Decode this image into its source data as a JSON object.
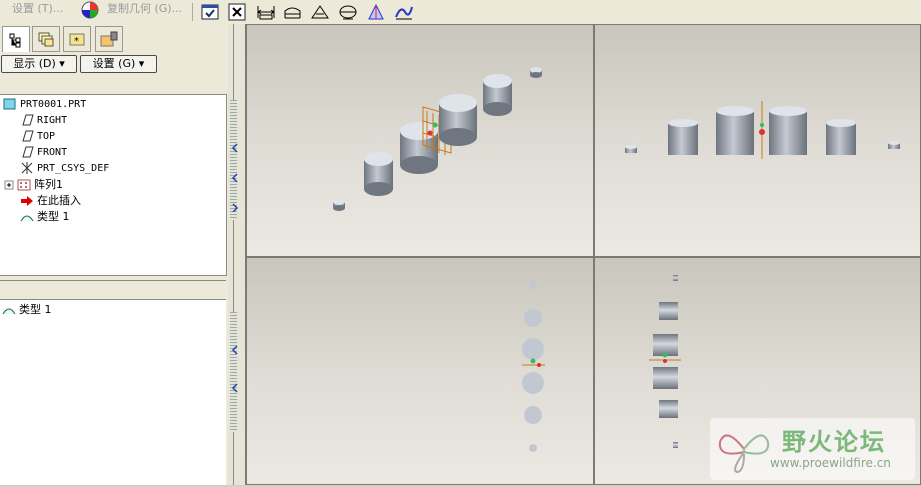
{
  "menubar": {
    "items": [
      "设置 (T)...",
      "复制几何 (G)..."
    ]
  },
  "toolbar": {
    "icons": [
      "copy-geometry-icon",
      "window-check-icon",
      "close-window-icon",
      "distance-icon",
      "plane-icon",
      "tangent-icon",
      "cylinder-section-icon",
      "color-shade-icon",
      "curve-analysis-icon"
    ]
  },
  "left_panel": {
    "tabs": [
      "model-tree-tab",
      "layers-tab",
      "favorites-tab",
      "feature-tab"
    ],
    "show_button": "显示 (D)",
    "settings_button": "设置 (G)",
    "tree": [
      {
        "label": "PRT0001.PRT",
        "icon": "part-icon"
      },
      {
        "label": "RIGHT",
        "icon": "datum-plane-icon"
      },
      {
        "label": "TOP",
        "icon": "datum-plane-icon"
      },
      {
        "label": "FRONT",
        "icon": "datum-plane-icon"
      },
      {
        "label": "PRT_CSYS_DEF",
        "icon": "csys-icon"
      },
      {
        "label": "阵列1",
        "icon": "pattern-icon"
      },
      {
        "label": "在此插入",
        "icon": "insert-arrow-icon"
      },
      {
        "label": "类型 1",
        "icon": "feature-type-icon"
      }
    ],
    "lower_item": "类型 1"
  },
  "watermark": {
    "title": "野火论坛",
    "url": "www.proewildfire.cn"
  }
}
